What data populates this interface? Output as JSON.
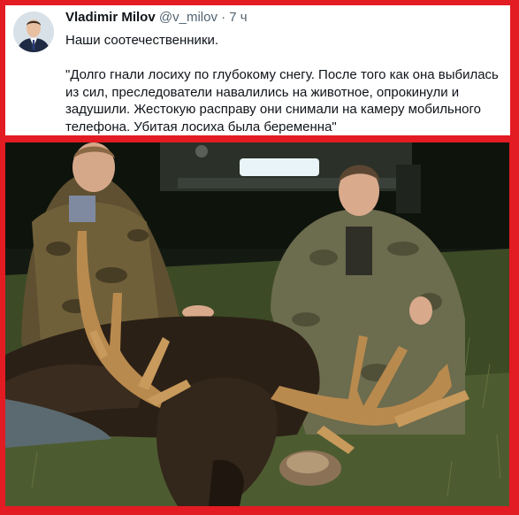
{
  "tweet": {
    "author_name": "Vladimir Milov",
    "handle": "@v_milov",
    "separator": "·",
    "time": "7 ч",
    "line1": "Наши соотечественники.",
    "quote_line1": "\"Долго гнали лосиху по глубокому снегу. После того как она выбилась",
    "quote_line2": "из сил, преследователи навалились на животное, опрокинули и",
    "quote_line3": "задушили. Жестокую расправу они снимали на камеру мобильного",
    "quote_line4": "телефона. Убитая лосиха была беременна\""
  },
  "colors": {
    "frame": "#e31b23",
    "text": "#0f1419",
    "secondary_text": "#536471"
  },
  "icons": {
    "avatar": "profile-photo"
  }
}
